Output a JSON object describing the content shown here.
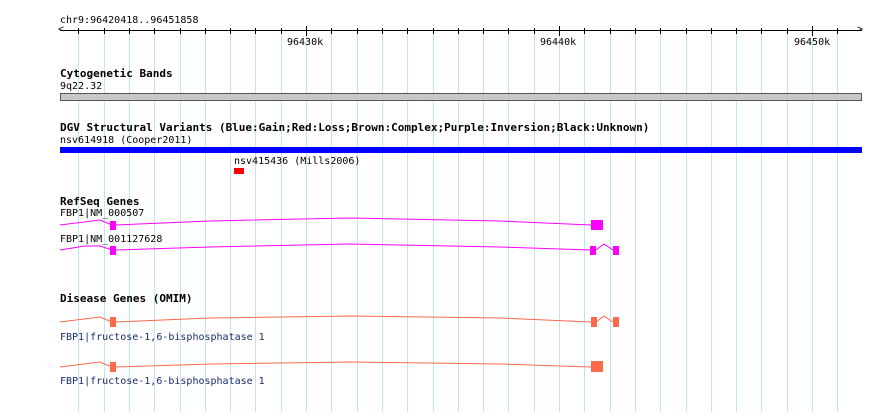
{
  "ruler": {
    "region": "chr9:96420418..96451858",
    "ticks": [
      "96430k",
      "96440k",
      "96450k"
    ]
  },
  "tracks": {
    "cytoband": {
      "title": "Cytogenetic Bands",
      "band": "9q22.32"
    },
    "dgv": {
      "title": "DGV Structural Variants (Blue:Gain;Red:Loss;Brown:Complex;Purple:Inversion;Black:Unknown)",
      "variant1": "nsv614918 (Cooper2011)",
      "variant2": "nsv415436 (Mills2006)",
      "gain_color": "#0000ff",
      "loss_color": "#ff0000"
    },
    "refseq": {
      "title": "RefSeq Genes",
      "gene1": "FBP1|NM_000507",
      "gene2": "FBP1|NM_001127628",
      "color": "#ff00ff"
    },
    "omim": {
      "title": "Disease Genes (OMIM)",
      "gene1": "FBP1|fructose-1,6-bisphosphatase 1",
      "gene2": "FBP1|fructose-1,6-bisphosphatase 1",
      "color": "#fa6a4b",
      "label_color": "#1a2a6c"
    }
  }
}
